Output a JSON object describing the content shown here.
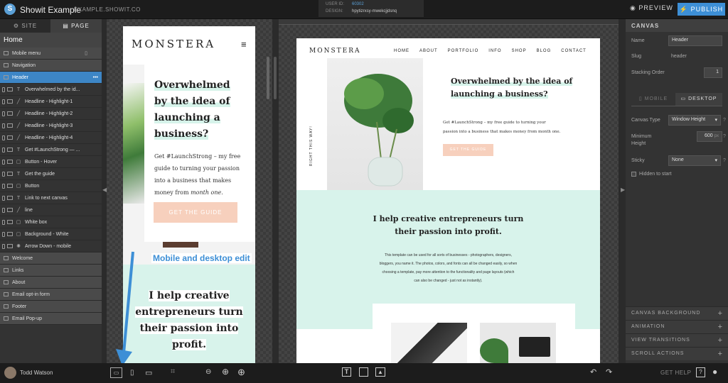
{
  "topbar": {
    "app_title": "Showit Example",
    "site_url": "EXAMPLE.SHOWIT.CO",
    "user_id_label": "USER ID:",
    "user_id": "60302",
    "design_label": "DESIGN:",
    "design_id": "hpytizrxsy-mwekcjjdsnq",
    "preview": "PREVIEW",
    "publish": "PUBLISH"
  },
  "sidebar": {
    "tab_site": "SITE",
    "tab_page": "PAGE",
    "page_name": "Home",
    "canvases_top": [
      "Mobile menu",
      "Navigation",
      "Header"
    ],
    "layers": [
      {
        "type": "T",
        "label": "Overwhelmed by the id..."
      },
      {
        "type": "line",
        "label": "Headline - Highlight-1"
      },
      {
        "type": "line",
        "label": "Headline - Highlight-2"
      },
      {
        "type": "line",
        "label": "Headline - Highlight-3"
      },
      {
        "type": "line",
        "label": "Headline - Highlight-4"
      },
      {
        "type": "T",
        "label": "Get #LaunchStrong — ..."
      },
      {
        "type": "box",
        "label": "Button - Hover"
      },
      {
        "type": "T",
        "label": "Get the guide"
      },
      {
        "type": "box",
        "label": "Button"
      },
      {
        "type": "T",
        "label": "Link to next canvas"
      },
      {
        "type": "line",
        "label": "line"
      },
      {
        "type": "box",
        "label": "White box"
      },
      {
        "type": "box",
        "label": "Background - White"
      },
      {
        "type": "icon",
        "label": "Arrow Down - mobile"
      }
    ],
    "canvases_bottom": [
      "Welcome",
      "Links",
      "About",
      "Email opt-in form",
      "Footer",
      "Email Pop-up"
    ]
  },
  "mobile": {
    "logo": "MONSTERA",
    "headline": [
      "Overwhelmed",
      "by the idea of",
      "launching a",
      "business?"
    ],
    "body_a": "Get #LaunchStrong – my free guide to turning your passion into a business that makes money from ",
    "body_em": "month one",
    "body_end": ".",
    "button": "GET THE GUIDE",
    "tagline": [
      "I help creative",
      "entrepreneurs turn",
      "their passion into",
      "profit."
    ]
  },
  "annotation": "Mobile and desktop edit",
  "desktop": {
    "logo": "MONSTERA",
    "nav": [
      "HOME",
      "ABOUT",
      "PORTFOLIO",
      "INFO",
      "SHOP",
      "BLOG",
      "CONTACT"
    ],
    "headline": [
      "Overwhelmed by the idea of",
      "launching a business?"
    ],
    "body": [
      "Get #LaunchStrong – my free guide to turning your",
      "passion into a business that makes money from month one."
    ],
    "button": "GET THE GUIDE",
    "vertical": "RIGHT THIS WAY!",
    "tagline": [
      "I help creative entrepreneurs turn",
      "their passion into profit."
    ],
    "paragraph": [
      "This template can be used for all sorts of businesses - photographers, designers,",
      "bloggers, you name it. The photos, colors, and fonts can all be changed easily, so when",
      "choosing a template, pay more attention to the functionality and page layouts (which",
      "can also be changed - just not as instantly)."
    ]
  },
  "panel": {
    "title": "CANVAS",
    "name_label": "Name",
    "name_value": "Header",
    "slug_label": "Slug",
    "slug_value": "header",
    "stacking_label": "Stacking Order",
    "stacking_value": "1",
    "tab_mobile": "MOBILE",
    "tab_desktop": "DESKTOP",
    "canvas_type_label": "Canvas Type",
    "canvas_type_value": "Window Height",
    "min_height_label": "Minimum Height",
    "min_height_value": "600",
    "min_height_unit": "px",
    "sticky_label": "Sticky",
    "sticky_value": "None",
    "hidden_label": "Hidden to start",
    "help": "?",
    "accordions": [
      "CANVAS BACKGROUND",
      "ANIMATION",
      "VIEW TRANSITIONS",
      "SCROLL ACTIONS"
    ]
  },
  "bottombar": {
    "user": "Todd Watson",
    "get_help": "GET HELP"
  },
  "colors": {
    "accent": "#3d86c6",
    "mint": "#d8f3eb",
    "peach": "#f7d0bd",
    "publish": "#3d8fd6"
  }
}
